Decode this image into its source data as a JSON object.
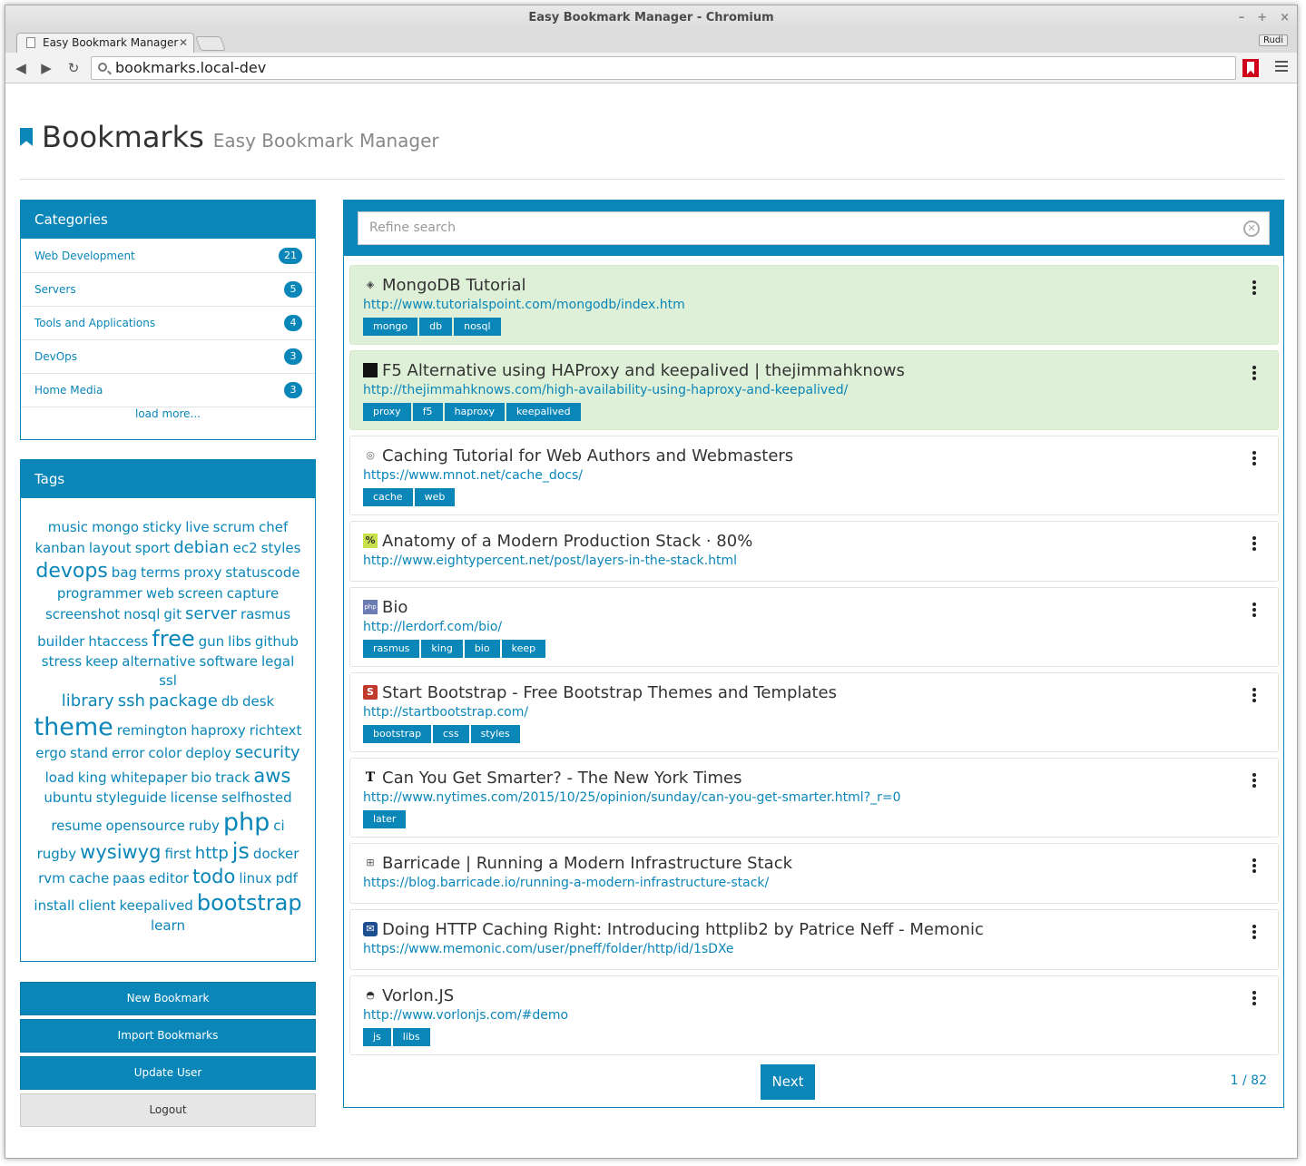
{
  "browser": {
    "window_title": "Easy Bookmark Manager - Chromium",
    "tab_title": "Easy Bookmark Manager",
    "profile": "Rudi",
    "url": "bookmarks.local-dev",
    "controls": [
      "–",
      "+",
      "×"
    ]
  },
  "header": {
    "title": "Bookmarks",
    "subtitle": "Easy Bookmark Manager"
  },
  "categories": {
    "heading": "Categories",
    "items": [
      {
        "label": "Web Development",
        "count": "21"
      },
      {
        "label": "Servers",
        "count": "5"
      },
      {
        "label": "Tools and Applications",
        "count": "4"
      },
      {
        "label": "DevOps",
        "count": "3"
      },
      {
        "label": "Home Media",
        "count": "3"
      }
    ],
    "load_more": "load more..."
  },
  "tags": {
    "heading": "Tags",
    "rows": [
      [
        [
          "music",
          15
        ],
        [
          "mongo",
          15
        ],
        [
          "sticky",
          15
        ],
        [
          "live",
          15
        ],
        [
          "scrum",
          15
        ],
        [
          "chef",
          15
        ]
      ],
      [
        [
          "kanban",
          15
        ],
        [
          "layout",
          15
        ],
        [
          "sport",
          15
        ],
        [
          "debian",
          18
        ],
        [
          "ec2",
          15
        ],
        [
          "styles",
          15
        ]
      ],
      [
        [
          "devops",
          22
        ],
        [
          "bag",
          15
        ],
        [
          "terms",
          15
        ],
        [
          "proxy",
          15
        ],
        [
          "statuscode",
          15
        ]
      ],
      [
        [
          "programmer",
          15
        ],
        [
          "web",
          15
        ],
        [
          "screen",
          15
        ],
        [
          "capture",
          15
        ]
      ],
      [
        [
          "screenshot",
          15
        ],
        [
          "nosql",
          15
        ],
        [
          "git",
          15
        ],
        [
          "server",
          18
        ],
        [
          "rasmus",
          15
        ]
      ],
      [
        [
          "builder",
          15
        ],
        [
          "htaccess",
          15
        ],
        [
          "free",
          24
        ],
        [
          "gun",
          15
        ],
        [
          "libs",
          15
        ],
        [
          "github",
          15
        ]
      ],
      [
        [
          "stress",
          15
        ],
        [
          "keep",
          15
        ],
        [
          "alternative",
          15
        ],
        [
          "software",
          15
        ],
        [
          "legal",
          15
        ],
        [
          "ssl",
          15
        ]
      ],
      [
        [
          "library",
          18
        ],
        [
          "ssh",
          18
        ],
        [
          "package",
          18
        ],
        [
          "db",
          15
        ],
        [
          "desk",
          15
        ]
      ],
      [
        [
          "theme",
          27
        ],
        [
          "remington",
          15
        ],
        [
          "haproxy",
          15
        ],
        [
          "richtext",
          15
        ]
      ],
      [
        [
          "ergo",
          15
        ],
        [
          "stand",
          15
        ],
        [
          "error",
          15
        ],
        [
          "color",
          15
        ],
        [
          "deploy",
          15
        ],
        [
          "security",
          18
        ]
      ],
      [
        [
          "load",
          15
        ],
        [
          "king",
          15
        ],
        [
          "whitepaper",
          15
        ],
        [
          "bio",
          15
        ],
        [
          "track",
          15
        ],
        [
          "aws",
          21
        ]
      ],
      [
        [
          "ubuntu",
          15
        ],
        [
          "styleguide",
          15
        ],
        [
          "license",
          15
        ],
        [
          "selfhosted",
          15
        ]
      ],
      [
        [
          "resume",
          15
        ],
        [
          "opensource",
          15
        ],
        [
          "ruby",
          15
        ],
        [
          "php",
          27
        ],
        [
          "ci",
          15
        ]
      ],
      [
        [
          "rugby",
          15
        ],
        [
          "wysiwyg",
          21
        ],
        [
          "first",
          15
        ],
        [
          "http",
          18
        ],
        [
          "js",
          24
        ],
        [
          "docker",
          15
        ]
      ],
      [
        [
          "rvm",
          15
        ],
        [
          "cache",
          15
        ],
        [
          "paas",
          15
        ],
        [
          "editor",
          15
        ],
        [
          "todo",
          21
        ],
        [
          "linux",
          15
        ],
        [
          "pdf",
          15
        ]
      ],
      [
        [
          "install",
          15
        ],
        [
          "client",
          15
        ],
        [
          "keepalived",
          15
        ],
        [
          "bootstrap",
          24
        ]
      ],
      [
        [
          "learn",
          15
        ]
      ]
    ]
  },
  "actions": {
    "new_bookmark": "New Bookmark",
    "import_bookmarks": "Import Bookmarks",
    "update_user": "Update User",
    "logout": "Logout"
  },
  "search": {
    "placeholder": "Refine search"
  },
  "bookmarks": [
    {
      "title": "MongoDB Tutorial",
      "url": "http://www.tutorialspoint.com/mongodb/index.htm",
      "tags": [
        "mongo",
        "db",
        "nosql"
      ],
      "highlight": true,
      "favicon": "diamond-icon"
    },
    {
      "title": "F5 Alternative using HAProxy and keepalived | thejimmahknows",
      "url": "http://thejimmahknows.com/high-availability-using-haproxy-and-keepalived/",
      "tags": [
        "proxy",
        "f5",
        "haproxy",
        "keepalived"
      ],
      "highlight": true,
      "favicon": "terminal-icon"
    },
    {
      "title": "Caching Tutorial for Web Authors and Webmasters",
      "url": "https://www.mnot.net/cache_docs/",
      "tags": [
        "cache",
        "web"
      ],
      "highlight": false,
      "favicon": "globe-icon"
    },
    {
      "title": "Anatomy of a Modern Production Stack · 80%",
      "url": "http://www.eightypercent.net/post/layers-in-the-stack.html",
      "tags": [],
      "highlight": false,
      "favicon": "percent-icon"
    },
    {
      "title": "Bio",
      "url": "http://lerdorf.com/bio/",
      "tags": [
        "rasmus",
        "king",
        "bio",
        "keep"
      ],
      "highlight": false,
      "favicon": "php-icon"
    },
    {
      "title": "Start Bootstrap - Free Bootstrap Themes and Templates",
      "url": "http://startbootstrap.com/",
      "tags": [
        "bootstrap",
        "css",
        "styles"
      ],
      "highlight": false,
      "favicon": "s-icon"
    },
    {
      "title": "Can You Get Smarter? - The New York Times",
      "url": "http://www.nytimes.com/2015/10/25/opinion/sunday/can-you-get-smarter.html?_r=0",
      "tags": [
        "later"
      ],
      "highlight": false,
      "favicon": "nyt-icon"
    },
    {
      "title": "Barricade | Running a Modern Infrastructure Stack",
      "url": "https://blog.barricade.io/running-a-modern-infrastructure-stack/",
      "tags": [],
      "highlight": false,
      "favicon": "barricade-icon"
    },
    {
      "title": "Doing HTTP Caching Right: Introducing httplib2 by Patrice Neff - Memonic",
      "url": "https://www.memonic.com/user/pneff/folder/http/id/1sDXe",
      "tags": [],
      "highlight": false,
      "favicon": "memonic-icon"
    },
    {
      "title": "Vorlon.JS",
      "url": "http://www.vorlonjs.com/#demo",
      "tags": [
        "js",
        "libs"
      ],
      "highlight": false,
      "favicon": "vorlon-icon"
    }
  ],
  "pagination": {
    "next": "Next",
    "indicator": "1 / 82"
  },
  "colors": {
    "accent": "#0a86b8",
    "highlight_bg": "#dff0d8"
  }
}
